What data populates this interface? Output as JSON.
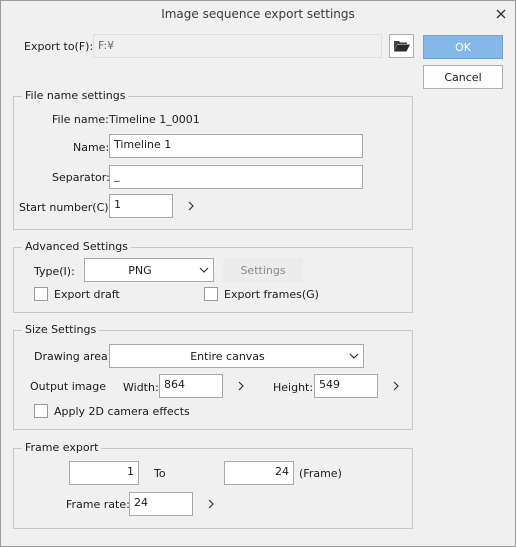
{
  "window": {
    "title": "Image sequence export settings"
  },
  "export_to": {
    "label": "Export to(F):",
    "value": "F:¥"
  },
  "buttons": {
    "ok": "OK",
    "cancel": "Cancel"
  },
  "file_name_settings": {
    "title": "File name settings",
    "file_name_label": "File name:",
    "file_name_value": "Timeline 1_0001",
    "name_label": "Name:",
    "name_value": "Timeline 1",
    "separator_label": "Separator:",
    "separator_value": "_",
    "start_number_label": "Start number(C):",
    "start_number_value": "1"
  },
  "advanced_settings": {
    "title": "Advanced Settings",
    "type_label": "Type(I):",
    "type_value": "PNG",
    "settings_button": "Settings",
    "export_draft_label": "Export draft",
    "export_draft_checked": false,
    "export_frames_label": "Export frames(G)",
    "export_frames_checked": false
  },
  "size_settings": {
    "title": "Size Settings",
    "drawing_area_label": "Drawing area:",
    "drawing_area_value": "Entire canvas",
    "output_image_label": "Output image",
    "width_label": "Width:",
    "width_value": "864",
    "height_label": "Height:",
    "height_value": "549",
    "apply_camera_label": "Apply 2D camera effects",
    "apply_camera_checked": false
  },
  "frame_export": {
    "title": "Frame export",
    "from_value": "1",
    "to_label": "To",
    "to_value": "24",
    "frame_unit_label": "(Frame)",
    "frame_rate_label": "Frame rate:",
    "frame_rate_value": "24"
  }
}
